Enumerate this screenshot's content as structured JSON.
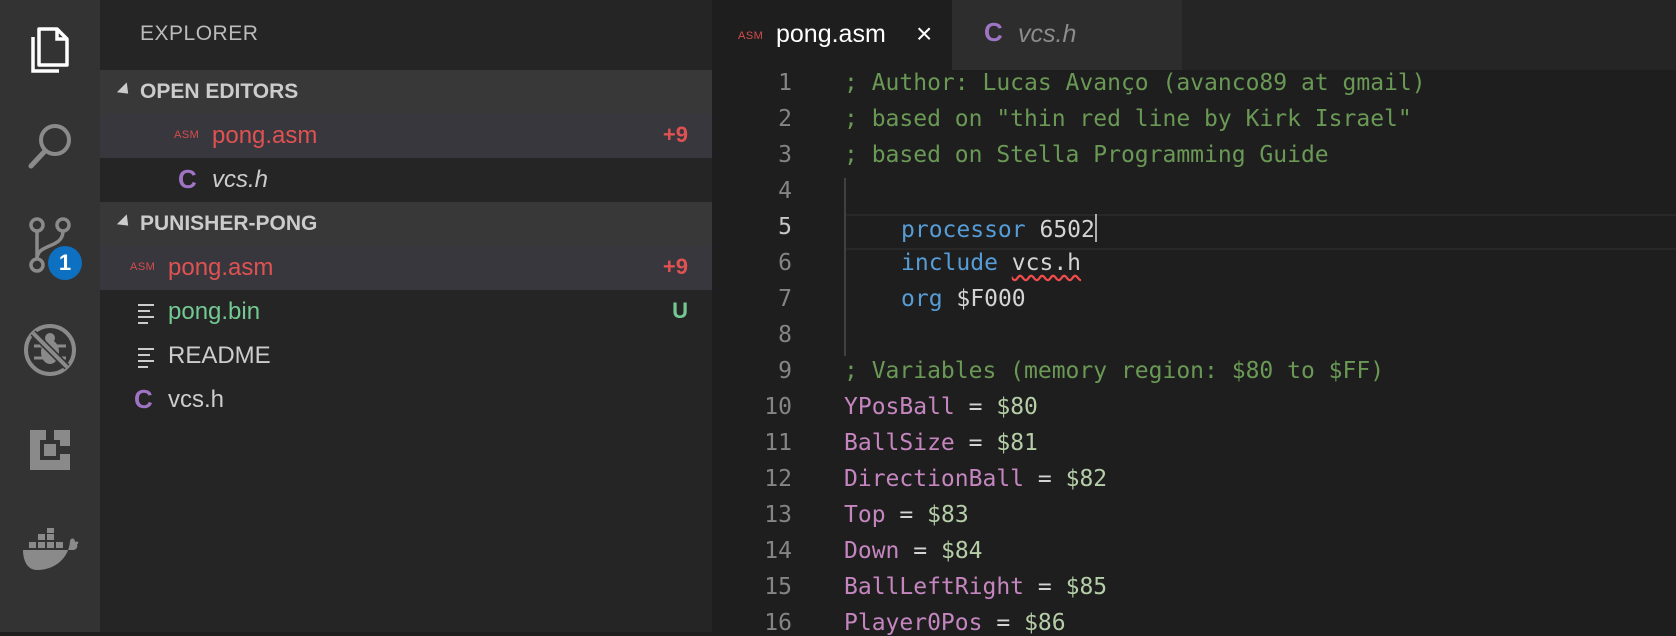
{
  "colors": {
    "accent": "#0e70c0",
    "modified": "#e05252",
    "untracked": "#73c991"
  },
  "activity_bar": {
    "items": [
      {
        "icon": "files-icon"
      },
      {
        "icon": "search-icon"
      },
      {
        "icon": "source-control-icon"
      },
      {
        "icon": "debug-icon"
      },
      {
        "icon": "extensions-icon"
      },
      {
        "icon": "docker-icon"
      }
    ],
    "scm_badge": "1"
  },
  "sidebar": {
    "title": "EXPLORER",
    "open_editors": {
      "header": "OPEN EDITORS",
      "items": [
        {
          "icon": "asm-icon",
          "icon_text": "ASM",
          "name": "pong.asm",
          "status": "+9"
        },
        {
          "icon": "c-icon",
          "icon_text": "C",
          "name": "vcs.h",
          "status": ""
        }
      ]
    },
    "project": {
      "header": "PUNISHER-PONG",
      "items": [
        {
          "icon": "asm-icon",
          "icon_text": "ASM",
          "name": "pong.asm",
          "status": "+9"
        },
        {
          "icon": "file-lines-icon",
          "name": "pong.bin",
          "status": "U"
        },
        {
          "icon": "file-lines-icon",
          "name": "README",
          "status": ""
        },
        {
          "icon": "c-icon",
          "icon_text": "C",
          "name": "vcs.h",
          "status": ""
        }
      ]
    }
  },
  "tabs": [
    {
      "icon_text": "ASM",
      "label": "pong.asm",
      "close": "×"
    },
    {
      "icon_text": "C",
      "label": "vcs.h"
    }
  ],
  "editor": {
    "lines": [
      {
        "n": "1",
        "text": "; Author: Lucas Avanço (avanco89 at gmail)"
      },
      {
        "n": "2",
        "text": "; based on \"thin red line by Kirk Israel\""
      },
      {
        "n": "3",
        "text": "; based on Stella Programming Guide"
      },
      {
        "n": "4",
        "text": ""
      },
      {
        "n": "5",
        "kw": "processor",
        "val": "6502"
      },
      {
        "n": "6",
        "kw": "include",
        "val": "vcs.h"
      },
      {
        "n": "7",
        "kw": "org",
        "val": "$F000"
      },
      {
        "n": "8",
        "text": ""
      },
      {
        "n": "9",
        "text": "; Variables (memory region: $80 to $FF)"
      },
      {
        "n": "10",
        "var": "YPosBall",
        "eq": "=",
        "val": "$80"
      },
      {
        "n": "11",
        "var": "BallSize",
        "eq": "=",
        "val": "$81"
      },
      {
        "n": "12",
        "var": "DirectionBall",
        "eq": "=",
        "val": "$82"
      },
      {
        "n": "13",
        "var": "Top",
        "eq": "=",
        "val": "$83"
      },
      {
        "n": "14",
        "var": "Down",
        "eq": "=",
        "val": "$84"
      },
      {
        "n": "15",
        "var": "BallLeftRight",
        "eq": "=",
        "val": "$85"
      },
      {
        "n": "16",
        "var": "Player0Pos",
        "eq": "=",
        "val": "$86"
      }
    ]
  }
}
